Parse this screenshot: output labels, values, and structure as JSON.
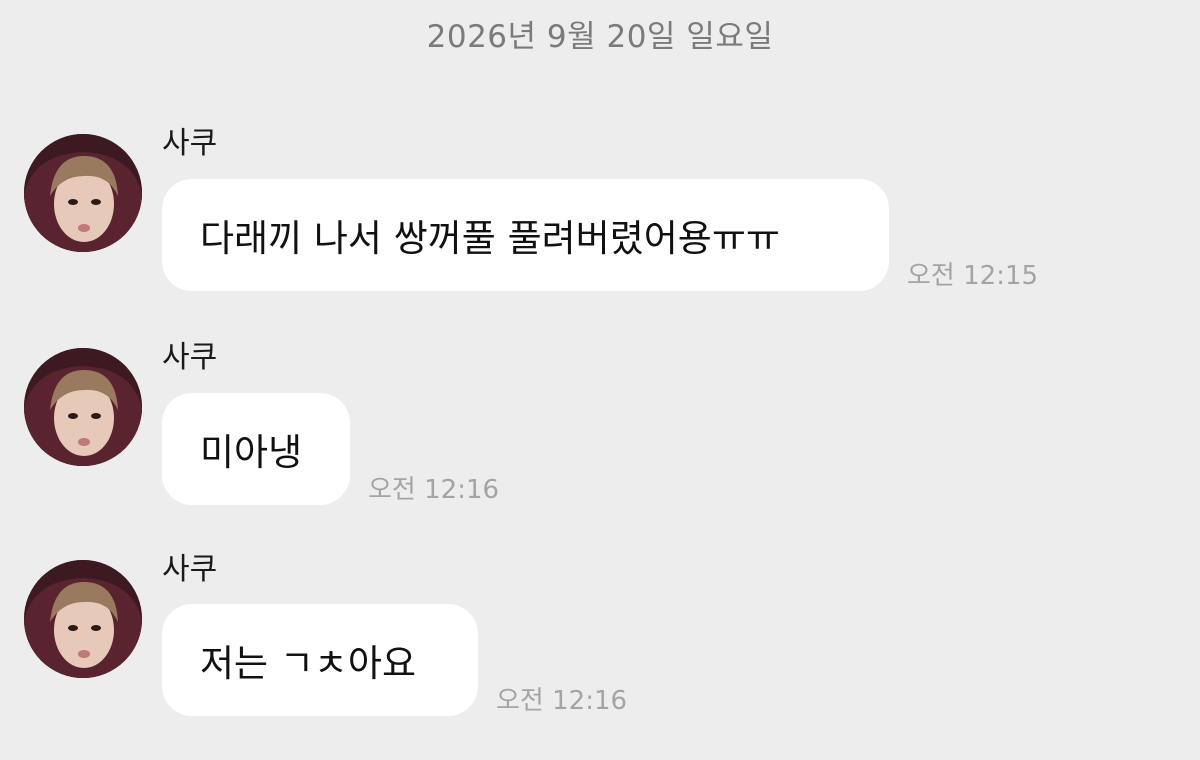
{
  "chat": {
    "date_header": "2026년 9월 20일 일요일",
    "messages": [
      {
        "sender": "사쿠",
        "text": "다래끼 나서 쌍꺼풀 풀려버렸어용ㅠㅠ",
        "time": "오전 12:15"
      },
      {
        "sender": "사쿠",
        "text": "미아냉",
        "time": "오전 12:16"
      },
      {
        "sender": "사쿠",
        "text": "저는 ㄱㅊ아요",
        "time": "오전 12:16"
      }
    ]
  },
  "colors": {
    "background": "#ededed",
    "bubble": "#ffffff",
    "date_text": "#7b7b7b",
    "time_text": "#a4a4a4"
  },
  "icons": {
    "avatar": "profile-photo-avatar"
  }
}
